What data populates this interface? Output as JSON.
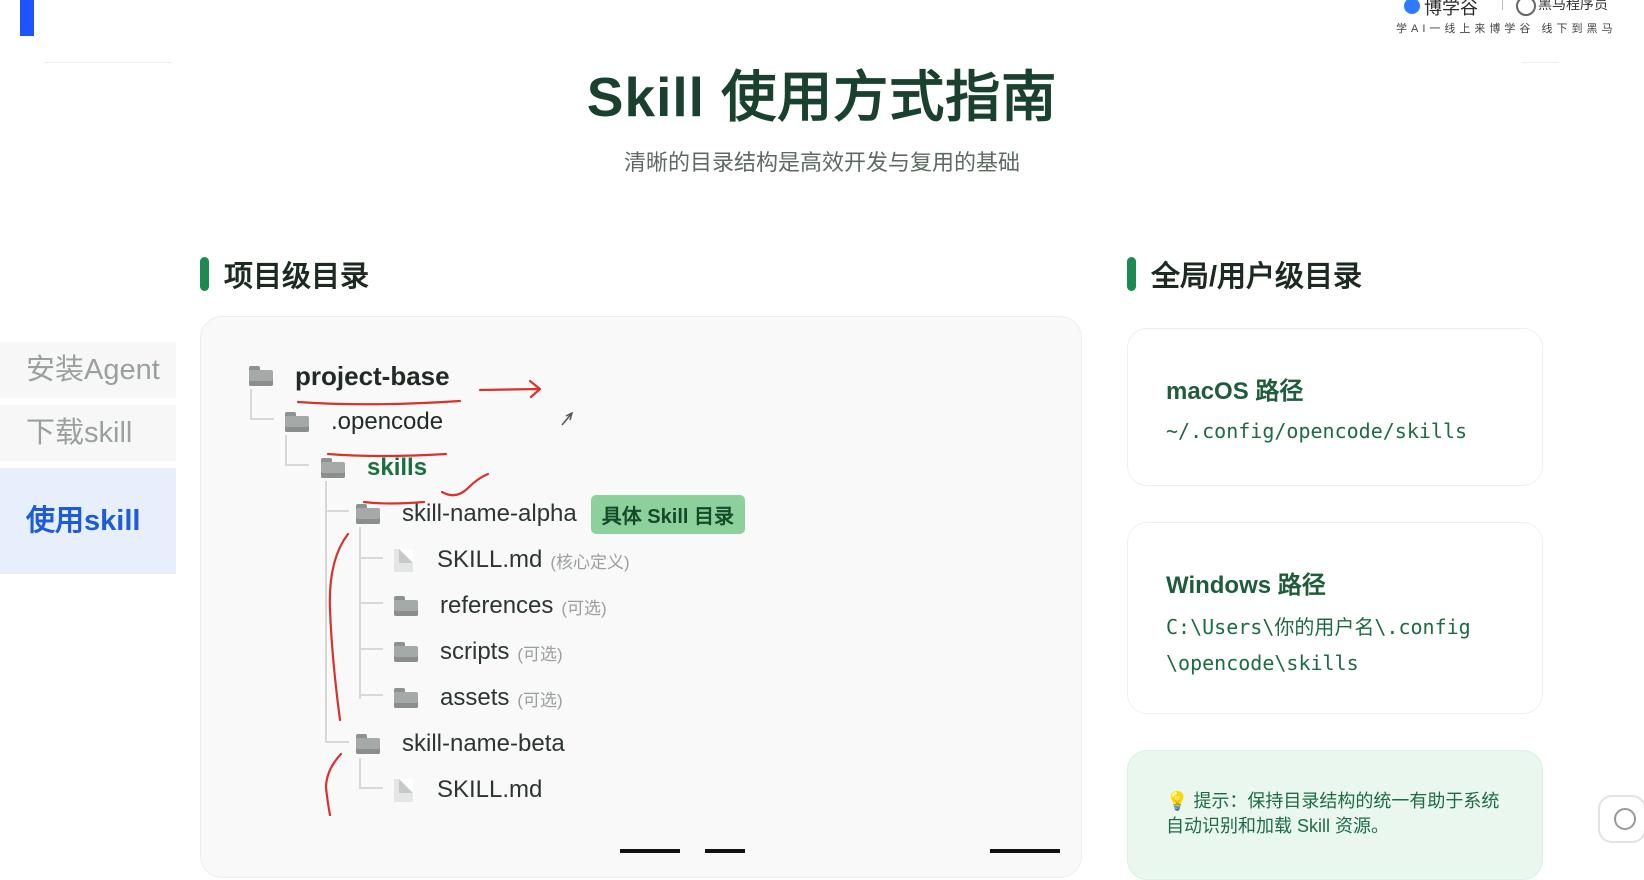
{
  "brand": {
    "name_left": "博学谷",
    "name_right": "黑马程序员",
    "slogan": "学AI一线上来博学谷 线下到黑马"
  },
  "sidebar": {
    "items": [
      {
        "label": "安装Agent",
        "active": false
      },
      {
        "label": "下载skill",
        "active": false
      },
      {
        "label": "使用skill",
        "active": true
      }
    ]
  },
  "page": {
    "title": "Skill 使用方式指南",
    "subtitle": "清晰的目录结构是高效开发与复用的基础"
  },
  "project_dir": {
    "heading": "项目级目录",
    "tree": {
      "root": "project-base",
      "opencode": ".opencode",
      "skills": "skills",
      "alpha": "skill-name-alpha",
      "alpha_tag": "具体 Skill 目录",
      "alpha_files": [
        {
          "name": "SKILL.md",
          "note": "(核心定义)",
          "kind": "file"
        },
        {
          "name": "references",
          "note": "(可选)",
          "kind": "folder"
        },
        {
          "name": "scripts",
          "note": "(可选)",
          "kind": "folder"
        },
        {
          "name": "assets",
          "note": "(可选)",
          "kind": "folder"
        }
      ],
      "beta": "skill-name-beta",
      "beta_files": [
        {
          "name": "SKILL.md",
          "kind": "file"
        }
      ]
    }
  },
  "global_dir": {
    "heading": "全局/用户级目录",
    "macos": {
      "title": "macOS 路径",
      "path": "~/.config/opencode/skills"
    },
    "windows": {
      "title": "Windows 路径",
      "path_line1": "C:\\Users\\你的用户名\\.config",
      "path_line2": "\\opencode\\skills"
    },
    "tip": {
      "icon": "lightbulb-icon",
      "text": "提示：保持目录结构的统一有助于系统自动识别和加载 Skill 资源。"
    }
  },
  "colors": {
    "accent_green": "#1d8a51",
    "title_green": "#19412d",
    "active_blue": "#1e5bd6",
    "annotation_red": "#d8322f"
  }
}
